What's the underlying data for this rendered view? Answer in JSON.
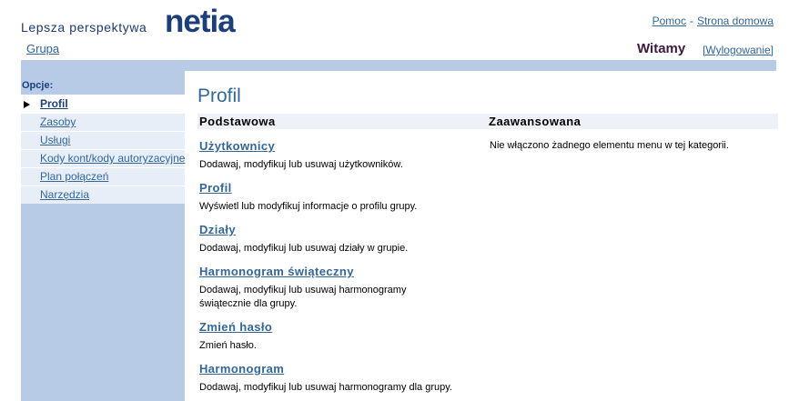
{
  "header": {
    "tagline": "Lepsza perspektywa",
    "brand": "netia",
    "group_link": "Grupa",
    "help_link": "Pomoc",
    "separator": "-",
    "home_link": "Strona domowa",
    "welcome": "Witamy",
    "logout": "[Wylogowanie]"
  },
  "sidebar": {
    "title": "Opcje:",
    "items": [
      {
        "label": "Profil",
        "active": true
      },
      {
        "label": "Zasoby"
      },
      {
        "label": "Usługi"
      },
      {
        "label": "Kody kont/kody autoryzacyjne"
      },
      {
        "label": "Plan połączeń"
      },
      {
        "label": "Narzędzia"
      }
    ]
  },
  "main": {
    "title": "Profil",
    "col_basic": "Podstawowa",
    "col_advanced": "Zaawansowana",
    "advanced_note": "Nie włączono żadnego elementu menu w tej kategorii.",
    "items": [
      {
        "title": "Użytkownicy",
        "desc": "Dodawaj, modyfikuj lub usuwaj użytkowników."
      },
      {
        "title": "Profil",
        "desc": "Wyświetl lub modyfikuj informacje o profilu grupy."
      },
      {
        "title": "Działy",
        "desc": "Dodawaj, modyfikuj lub usuwaj działy w grupie."
      },
      {
        "title": "Harmonogram świąteczny",
        "desc": "Dodawaj, modyfikuj lub usuwaj harmonogramy świątecznie dla grupy."
      },
      {
        "title": "Zmień hasło",
        "desc": "Zmień hasło."
      },
      {
        "title": "Harmonogram",
        "desc": "Dodawaj, modyfikuj lub usuwaj harmonogramy dla grupy."
      }
    ]
  }
}
